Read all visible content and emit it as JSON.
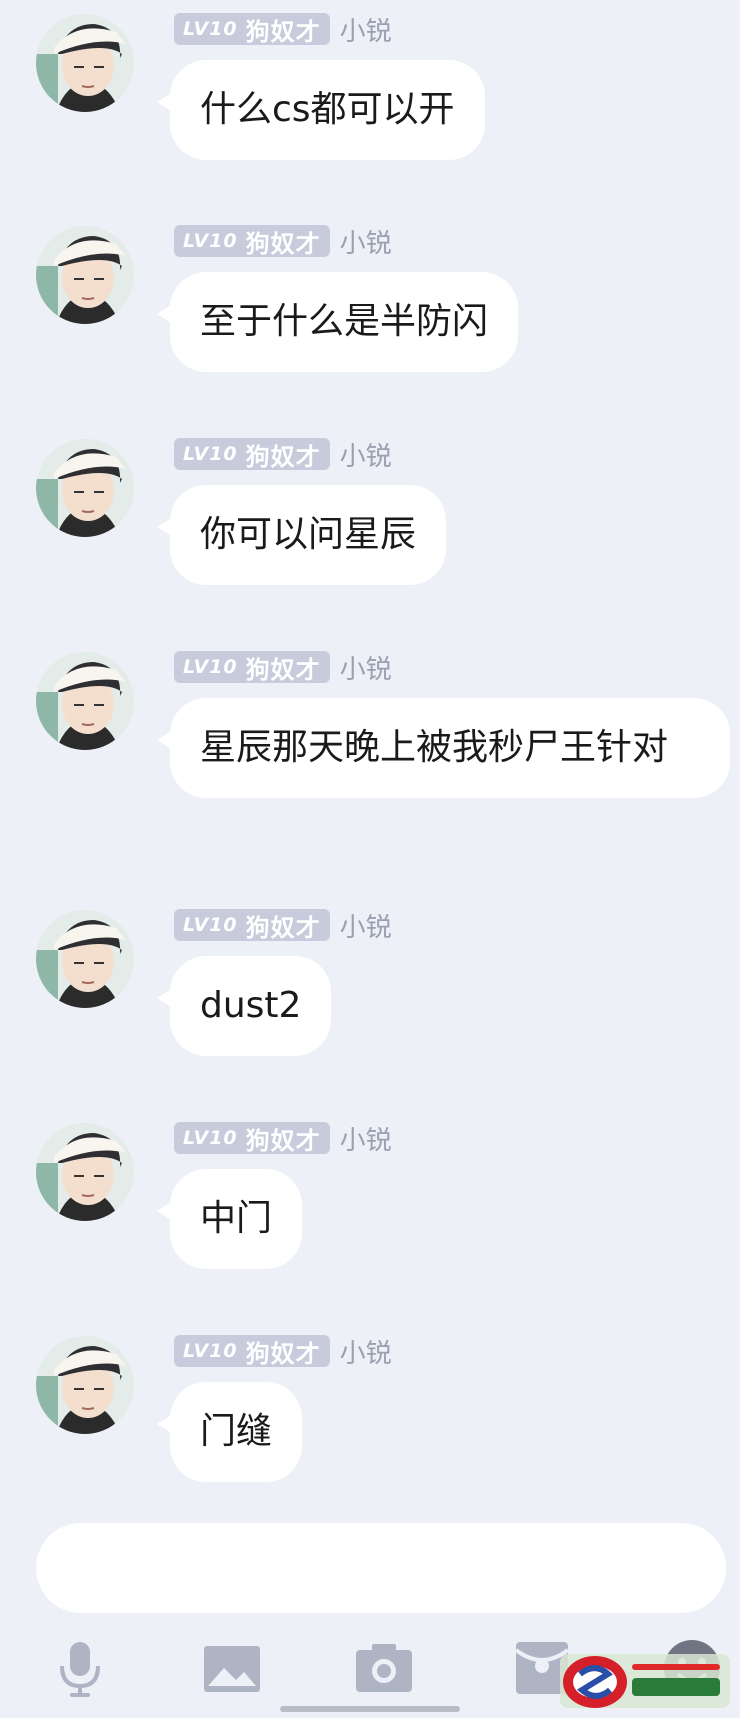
{
  "sender": {
    "level": "LV10",
    "title": "狗奴才",
    "nickname": "小锐"
  },
  "messages": [
    {
      "text": "什么cs都可以开"
    },
    {
      "text": "至于什么是半防闪"
    },
    {
      "text": "你可以问星辰"
    },
    {
      "text": "星辰那天晚上被我秒尸王针对"
    },
    {
      "text": "dust2"
    },
    {
      "text": "中门"
    },
    {
      "text": "门缝"
    }
  ],
  "input": {
    "value": ""
  },
  "toolbar": {
    "icons": [
      "microphone-icon",
      "image-icon",
      "camera-icon",
      "red-packet-icon",
      "emoji-icon"
    ]
  },
  "colors": {
    "background": "#eef0f7",
    "bubble": "#ffffff",
    "badge": "#c7cbdc",
    "nickname": "#9aa0b0"
  }
}
